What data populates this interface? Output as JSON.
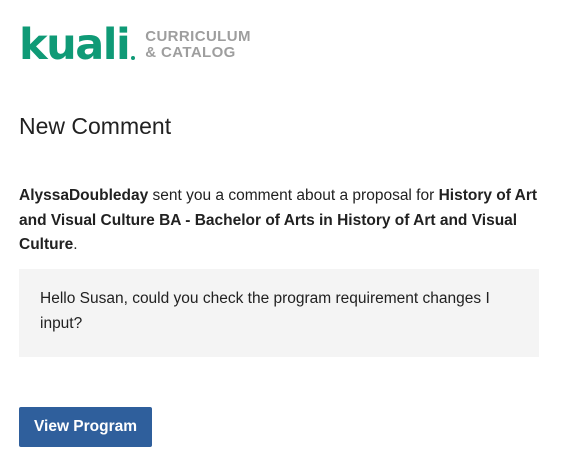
{
  "logo": {
    "wordmark": "kuali",
    "subtitle_line1": "CURRICULUM",
    "subtitle_line2": "& CATALOG",
    "brand_color": "#0f9a76",
    "subtitle_color": "#9e9e9e"
  },
  "title": "New Comment",
  "message": {
    "sender": "AlyssaDoubleday",
    "middle": " sent you a comment about a proposal for ",
    "proposal": "History of Art and Visual Culture BA - Bachelor of Arts in History of Art and Visual Culture",
    "end": "."
  },
  "comment": {
    "text": "Hello Susan, could you check the program requirement changes I input?"
  },
  "button": {
    "label": "View Program",
    "color": "#2f5f9c"
  }
}
